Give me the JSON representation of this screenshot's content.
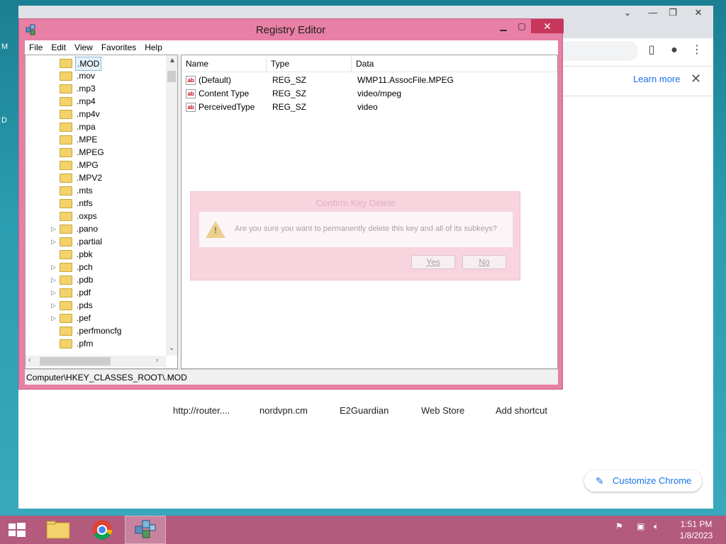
{
  "chrome": {
    "learn_more": "Learn more",
    "shortcuts": [
      "http://router....",
      "nordvpn.cm",
      "E2Guardian",
      "Web Store",
      "Add shortcut"
    ],
    "customize": "Customize Chrome",
    "left_edge_1": "M",
    "left_edge_2": "D"
  },
  "regedit": {
    "title": "Registry Editor",
    "menu": [
      "File",
      "Edit",
      "View",
      "Favorites",
      "Help"
    ],
    "tree": [
      {
        "label": ".MOD",
        "expander": false,
        "selected": true
      },
      {
        "label": ".mov",
        "expander": false
      },
      {
        "label": ".mp3",
        "expander": false
      },
      {
        "label": ".mp4",
        "expander": false
      },
      {
        "label": ".mp4v",
        "expander": false
      },
      {
        "label": ".mpa",
        "expander": false
      },
      {
        "label": ".MPE",
        "expander": false
      },
      {
        "label": ".MPEG",
        "expander": false
      },
      {
        "label": ".MPG",
        "expander": false
      },
      {
        "label": ".MPV2",
        "expander": false
      },
      {
        "label": ".mts",
        "expander": false
      },
      {
        "label": ".ntfs",
        "expander": false
      },
      {
        "label": ".oxps",
        "expander": false
      },
      {
        "label": ".pano",
        "expander": true
      },
      {
        "label": ".partial",
        "expander": true
      },
      {
        "label": ".pbk",
        "expander": false
      },
      {
        "label": ".pch",
        "expander": true
      },
      {
        "label": ".pdb",
        "expander": true
      },
      {
        "label": ".pdf",
        "expander": true
      },
      {
        "label": ".pds",
        "expander": true
      },
      {
        "label": ".pef",
        "expander": true
      },
      {
        "label": ".perfmoncfg",
        "expander": false
      },
      {
        "label": ".pfm",
        "expander": false
      }
    ],
    "columns": [
      "Name",
      "Type",
      "Data"
    ],
    "values": [
      {
        "name": "(Default)",
        "type": "REG_SZ",
        "data": "WMP11.AssocFile.MPEG"
      },
      {
        "name": "Content Type",
        "type": "REG_SZ",
        "data": "video/mpeg"
      },
      {
        "name": "PerceivedType",
        "type": "REG_SZ",
        "data": "video"
      }
    ],
    "status": "Computer\\HKEY_CLASSES_ROOT\\.MOD"
  },
  "dialog": {
    "title": "Confirm Key Delete",
    "message": "Are you sure you want to permanently delete this key and all of its subkeys?",
    "yes": "Yes",
    "no": "No"
  },
  "taskbar": {
    "time": "1:51 PM",
    "date": "1/8/2023"
  }
}
